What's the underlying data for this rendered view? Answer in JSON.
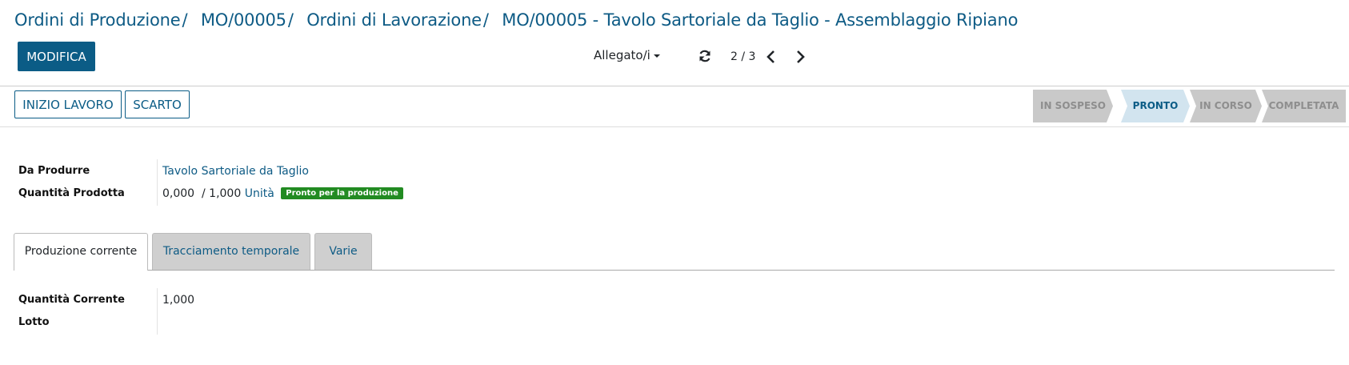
{
  "breadcrumb": {
    "items": [
      "Ordini di Produzione",
      "MO/00005",
      "Ordini di Lavorazione"
    ],
    "current": "MO/00005 - Tavolo Sartoriale da Taglio - Assemblaggio Ripiano",
    "separator": "/"
  },
  "toolbar": {
    "edit_label": "MODIFICA",
    "attachments_label": "Allegato/i",
    "pager_value": "2 / 3"
  },
  "actions": {
    "start_label": "INIZIO LAVORO",
    "scrap_label": "SCARTO"
  },
  "statusbar": {
    "steps": [
      "IN SOSPESO",
      "PRONTO",
      "IN CORSO",
      "COMPLETATA"
    ],
    "active": "PRONTO"
  },
  "form": {
    "product_label": "Da Produrre",
    "product_value": "Tavolo Sartoriale da Taglio",
    "qty_label": "Quantità Prodotta",
    "qty_done": "0,000",
    "qty_total": "/ 1,000",
    "uom": "Unità",
    "status_badge": "Pronto per la produzione"
  },
  "tabs": [
    {
      "label": "Produzione corrente"
    },
    {
      "label": "Tracciamento temporale"
    },
    {
      "label": "Varie"
    }
  ],
  "current_production": {
    "qty_label": "Quantità Corrente",
    "qty_value": "1,000",
    "lot_label": "Lotto"
  },
  "colors": {
    "primary": "#0b5c86",
    "link": "#0e5b85",
    "badge": "#228b22",
    "step_active_bg": "#d2e4ef",
    "step_bg": "#c9c9c9"
  }
}
